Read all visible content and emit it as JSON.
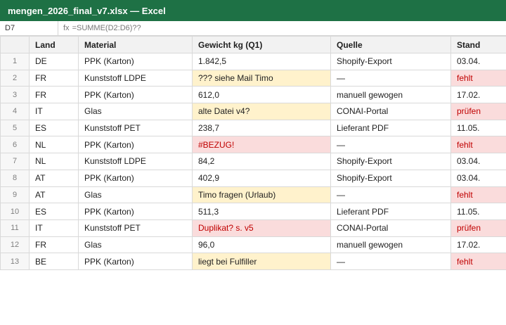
{
  "window": {
    "title": "mengen_2026_final_v7.xlsx — Excel"
  },
  "formula_bar": {
    "cell_ref": "D7",
    "fx_label": "fx",
    "formula": "=SUMME(D2:D6)??"
  },
  "colors": {
    "title_bar": "#1e7145",
    "warn_fill": "#fff2cc",
    "error_fill": "#fadcdc",
    "error_text": "#c00000"
  },
  "sheet": {
    "headers": [
      "Land",
      "Material",
      "Gewicht kg (Q1)",
      "Quelle",
      "Stand"
    ],
    "rows": [
      {
        "num": "1",
        "land": "DE",
        "material": "PPK (Karton)",
        "gewicht": "1.842,5",
        "gewicht_flag": "",
        "quelle": "Shopify-Export",
        "stand": "03.04.",
        "stand_flag": ""
      },
      {
        "num": "2",
        "land": "FR",
        "material": "Kunststoff LDPE",
        "gewicht": "??? siehe Mail Timo",
        "gewicht_flag": "warn",
        "quelle": "—",
        "stand": "fehlt",
        "stand_flag": "err"
      },
      {
        "num": "3",
        "land": "FR",
        "material": "PPK (Karton)",
        "gewicht": "612,0",
        "gewicht_flag": "",
        "quelle": "manuell gewogen",
        "stand": "17.02.",
        "stand_flag": ""
      },
      {
        "num": "4",
        "land": "IT",
        "material": "Glas",
        "gewicht": "alte Datei v4?",
        "gewicht_flag": "warn",
        "quelle": "CONAI-Portal",
        "stand": "prüfen",
        "stand_flag": "err"
      },
      {
        "num": "5",
        "land": "ES",
        "material": "Kunststoff PET",
        "gewicht": "238,7",
        "gewicht_flag": "",
        "quelle": "Lieferant PDF",
        "stand": "11.05.",
        "stand_flag": ""
      },
      {
        "num": "6",
        "land": "NL",
        "material": "PPK (Karton)",
        "gewicht": "#BEZUG!",
        "gewicht_flag": "err",
        "quelle": "—",
        "stand": "fehlt",
        "stand_flag": "err"
      },
      {
        "num": "7",
        "land": "NL",
        "material": "Kunststoff LDPE",
        "gewicht": "84,2",
        "gewicht_flag": "",
        "quelle": "Shopify-Export",
        "stand": "03.04.",
        "stand_flag": ""
      },
      {
        "num": "8",
        "land": "AT",
        "material": "PPK (Karton)",
        "gewicht": "402,9",
        "gewicht_flag": "",
        "quelle": "Shopify-Export",
        "stand": "03.04.",
        "stand_flag": ""
      },
      {
        "num": "9",
        "land": "AT",
        "material": "Glas",
        "gewicht": "Timo fragen (Urlaub)",
        "gewicht_flag": "warn",
        "quelle": "—",
        "stand": "fehlt",
        "stand_flag": "err"
      },
      {
        "num": "10",
        "land": "ES",
        "material": "PPK (Karton)",
        "gewicht": "511,3",
        "gewicht_flag": "",
        "quelle": "Lieferant PDF",
        "stand": "11.05.",
        "stand_flag": ""
      },
      {
        "num": "11",
        "land": "IT",
        "material": "Kunststoff PET",
        "gewicht": "Duplikat? s. v5",
        "gewicht_flag": "err",
        "quelle": "CONAI-Portal",
        "stand": "prüfen",
        "stand_flag": "err"
      },
      {
        "num": "12",
        "land": "FR",
        "material": "Glas",
        "gewicht": "96,0",
        "gewicht_flag": "",
        "quelle": "manuell gewogen",
        "stand": "17.02.",
        "stand_flag": ""
      },
      {
        "num": "13",
        "land": "BE",
        "material": "PPK (Karton)",
        "gewicht": "liegt bei Fulfiller",
        "gewicht_flag": "warn",
        "quelle": "—",
        "stand": "fehlt",
        "stand_flag": "err"
      }
    ]
  }
}
